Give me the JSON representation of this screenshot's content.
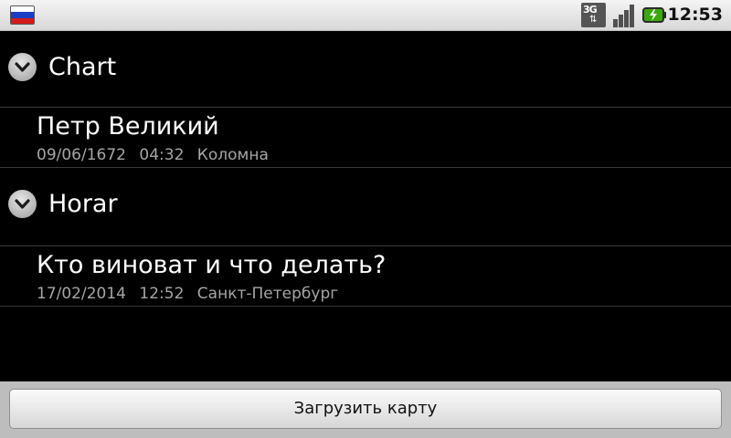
{
  "status_bar": {
    "clock": "12:53",
    "network_label": "3G",
    "icons": [
      "russian-flag-icon",
      "network-3g-icon",
      "signal-strength-icon",
      "battery-charging-icon"
    ],
    "colors": {
      "bar_bg": "#e6e6e6",
      "flag_white": "#ffffff",
      "flag_blue": "#1a3fc4",
      "flag_red": "#d21c1c",
      "battery_green": "#3aa80e"
    }
  },
  "groups": [
    {
      "title": "Chart",
      "expand_icon": "chevron-down-icon",
      "items": [
        {
          "title": "Петр Великий",
          "date": "09/06/1672",
          "time": "04:32",
          "place": "Коломна"
        }
      ]
    },
    {
      "title": "Horar",
      "expand_icon": "chevron-down-icon",
      "items": [
        {
          "title": "Кто виноват и что делать?",
          "date": "17/02/2014",
          "time": "12:52",
          "place": "Санкт-Петербург"
        }
      ]
    }
  ],
  "footer": {
    "load_button_label": "Загрузить карту"
  },
  "colors": {
    "background": "#000000",
    "primary_text": "#ffffff",
    "secondary_text": "#a6a6a6",
    "divider": "#3a3a3a"
  }
}
